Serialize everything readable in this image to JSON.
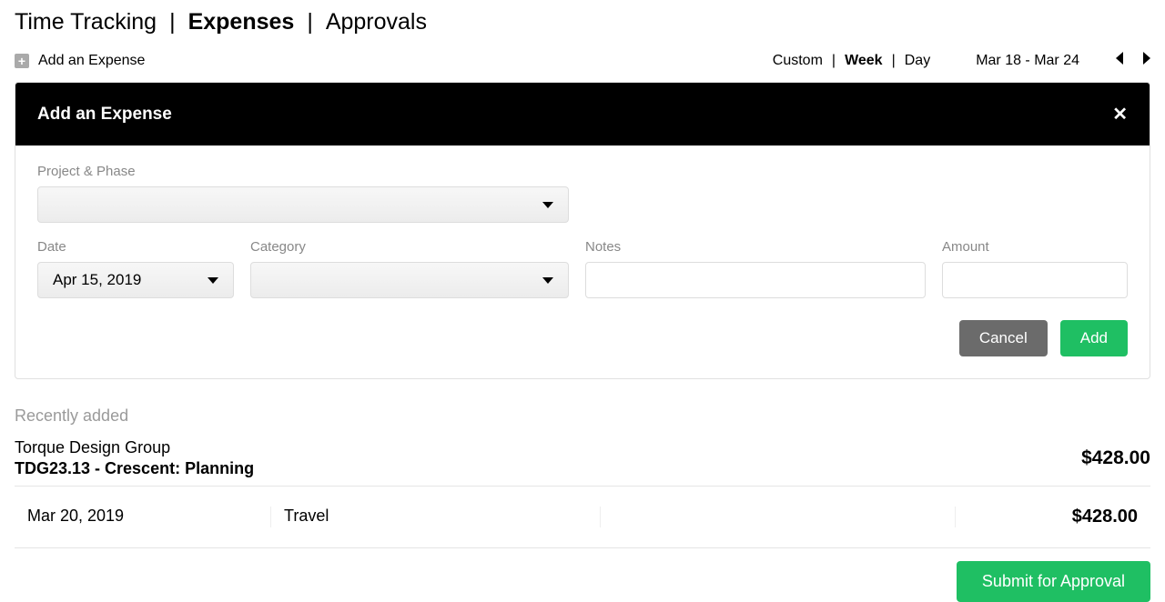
{
  "nav": {
    "items": [
      "Time Tracking",
      "Expenses",
      "Approvals"
    ],
    "active_index": 1
  },
  "add_link_label": "Add an Expense",
  "range": {
    "options": [
      "Custom",
      "Week",
      "Day"
    ],
    "active_index": 1,
    "date_range": "Mar 18 - Mar 24"
  },
  "panel": {
    "title": "Add an Expense",
    "fields": {
      "project_phase_label": "Project & Phase",
      "project_phase_value": "",
      "date_label": "Date",
      "date_value": "Apr 15, 2019",
      "category_label": "Category",
      "category_value": "",
      "notes_label": "Notes",
      "notes_value": "",
      "amount_label": "Amount",
      "amount_value": ""
    },
    "cancel_label": "Cancel",
    "add_label": "Add"
  },
  "recently_label": "Recently added",
  "group": {
    "client": "Torque Design Group",
    "project": "TDG23.13 - Crescent: Planning",
    "total": "$428.00"
  },
  "rows": [
    {
      "date": "Mar 20, 2019",
      "category": "Travel",
      "notes": "",
      "amount": "$428.00"
    }
  ],
  "submit_label": "Submit for Approval"
}
